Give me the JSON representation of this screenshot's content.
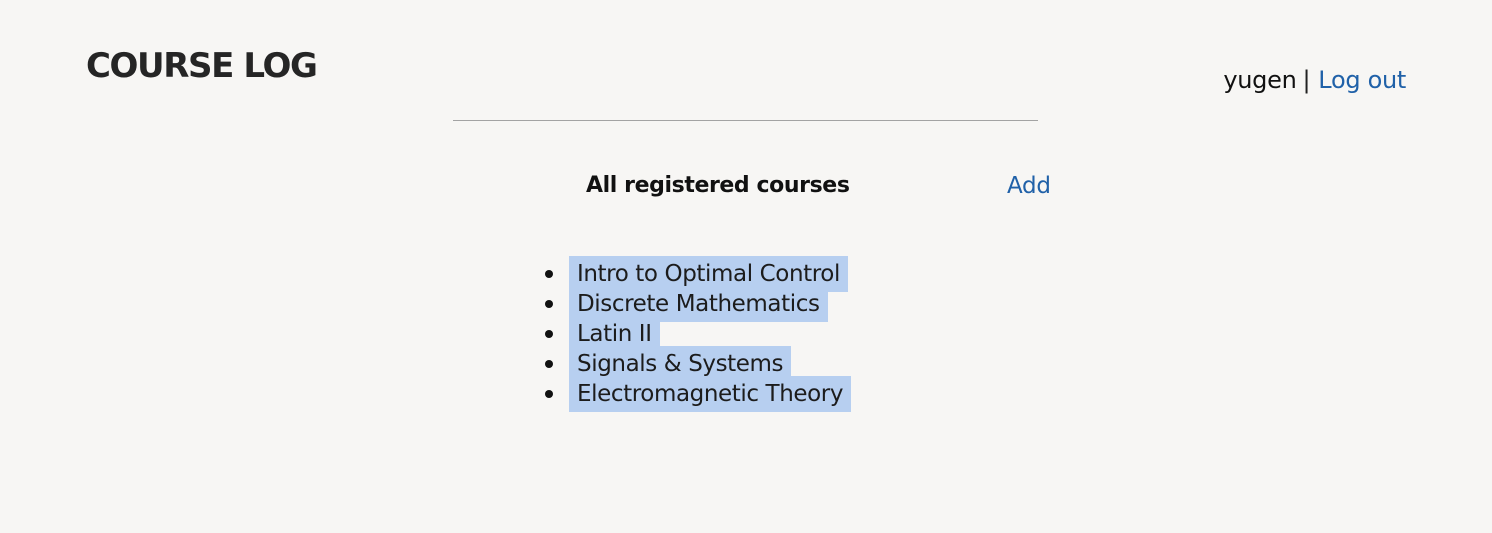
{
  "app": {
    "title": "COURSE LOG"
  },
  "account": {
    "username": "yugen",
    "separator": "|",
    "logout_label": "Log out"
  },
  "courses_section": {
    "title": "All registered courses",
    "add_label": "Add",
    "items": [
      "Intro to Optimal Control",
      "Discrete Mathematics",
      "Latin II",
      "Signals & Systems",
      "Electromagnetic Theory"
    ]
  },
  "colors": {
    "background": "#f7f6f4",
    "link": "#2061a8",
    "selection_highlight": "#b7cff0",
    "text": "#111111"
  }
}
